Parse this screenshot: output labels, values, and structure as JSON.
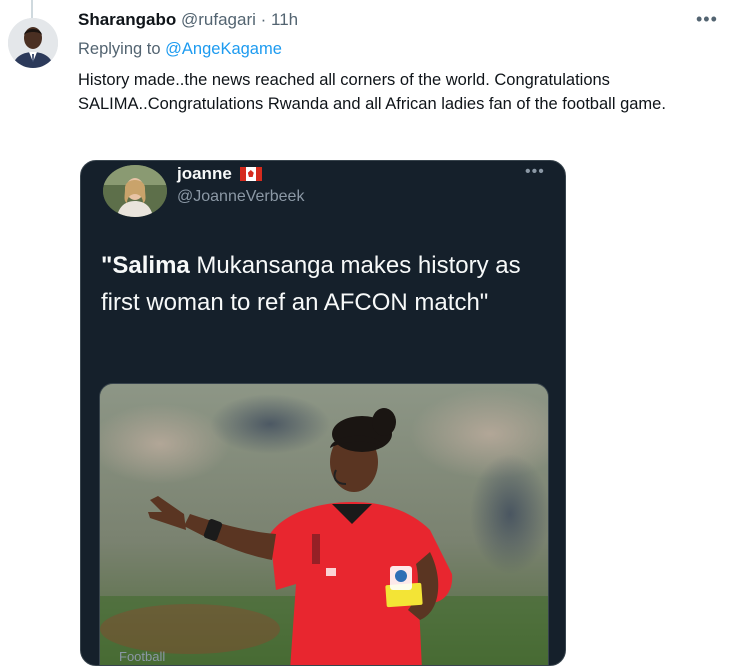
{
  "tweet": {
    "display_name": "Sharangabo",
    "handle": "@rufagari",
    "separator": "·",
    "time": "11h",
    "more_icon": "more-horizontal-icon",
    "reply_prefix": "Replying to",
    "reply_mention": "@AngeKagame",
    "body": "History made..the news reached all corners of the world. Congratulations SALIMA..Congratulations Rwanda and all African ladies fan of the football game."
  },
  "quote": {
    "display_name": "joanne",
    "flag": "canada-flag-icon",
    "handle": "@JoanneVerbeek",
    "text_bold": "\"Salima",
    "text_rest": " Mukansanga makes history as first woman to ref an AFCON match\"",
    "media_label": "Football"
  },
  "colors": {
    "mention": "#1d9bf0",
    "quote_background": "#15202b",
    "referee_shirt": "#e8262f"
  }
}
